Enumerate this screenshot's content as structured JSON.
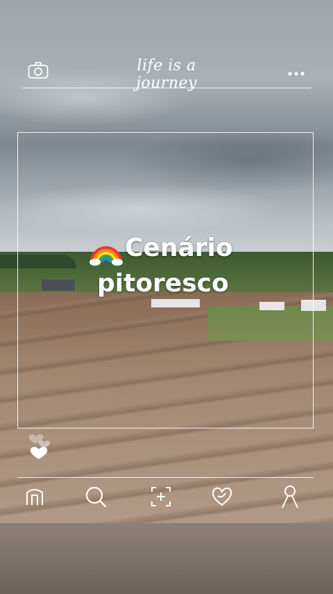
{
  "header": {
    "title": "life is a journey",
    "left_icon": "camera-icon",
    "right_icon": "more-icon"
  },
  "post": {
    "emoji": "rainbow",
    "headline_line1": "Cenário",
    "headline_line2": "pitoresco"
  },
  "reactions": {
    "icons": [
      "heart-icon",
      "heart-icon",
      "heart-icon"
    ]
  },
  "nav": {
    "items": [
      {
        "icon": "home-icon"
      },
      {
        "icon": "search-icon"
      },
      {
        "icon": "add-post-icon"
      },
      {
        "icon": "heart-icon"
      },
      {
        "icon": "profile-icon"
      }
    ]
  },
  "colors": {
    "overlay": "#ffffff",
    "sky": "#a9b0b6",
    "soil": "#a48a74",
    "vegetation": "#4d6a3a"
  }
}
